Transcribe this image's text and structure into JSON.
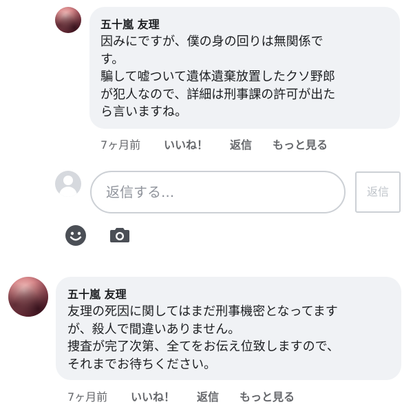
{
  "comments": [
    {
      "author": "五十嵐 友理",
      "lines": [
        "因みにですが、僕の身の回りは無関係で",
        "す。",
        "騙して嘘ついて遺体遺棄放置したクソ野郎",
        "が犯人なので、詳細は刑事課の許可が出た",
        "ら言いますね。"
      ],
      "time": "7ヶ月前",
      "like_label": "いいね！",
      "reply_label": "返信",
      "more_label": "もっと見る"
    },
    {
      "author": "五十嵐 友理",
      "lines": [
        "友理の死因に関してはまだ刑事機密となってます",
        "が、殺人で間違いありません。",
        "捜査が完了次第、全てをお伝え位致しますので、",
        "それまでお待ちください。"
      ],
      "time": "7ヶ月前",
      "like_label": "いいね！",
      "reply_label": "返信",
      "more_label": "もっと見る"
    }
  ],
  "reply_box": {
    "placeholder": "返信する...",
    "button_label": "返信"
  },
  "icons": [
    "emoji-icon",
    "camera-icon",
    "default-avatar-icon"
  ],
  "colors": {
    "bubble": "#f0f2f5",
    "text": "#1c1e21",
    "meta": "#65676b",
    "border": "#ccd0d5",
    "icon": "#4b4f56"
  }
}
